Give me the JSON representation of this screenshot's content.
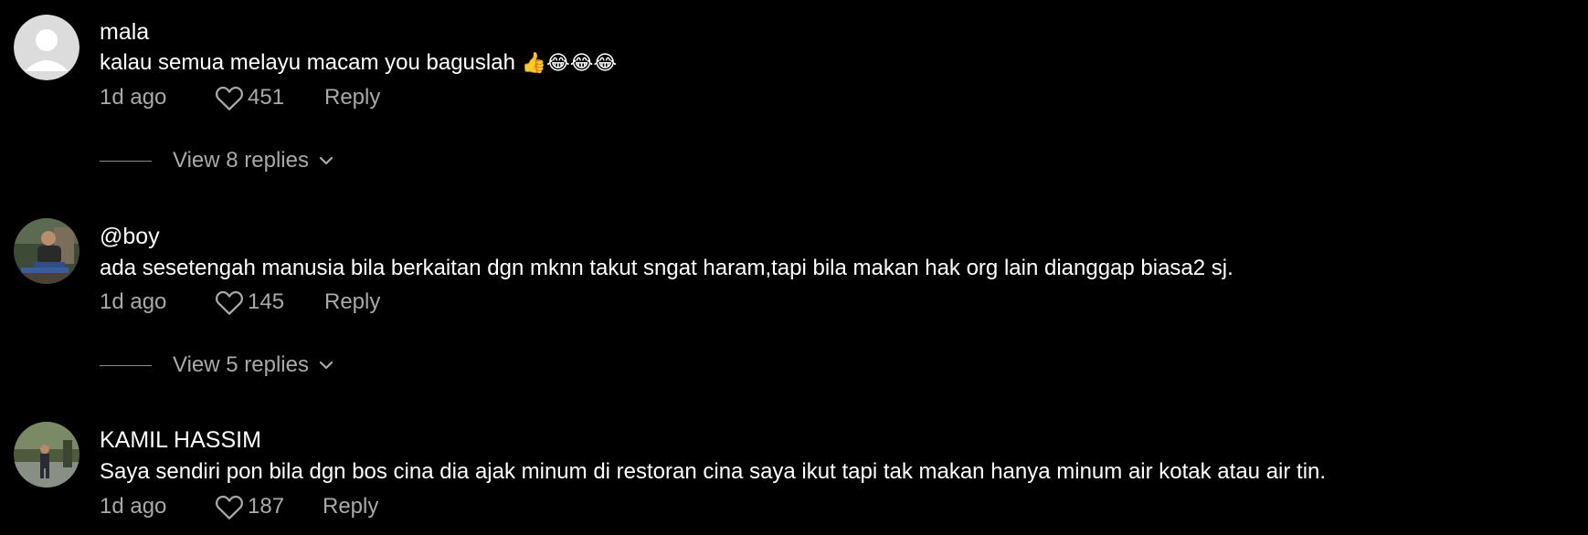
{
  "comments": [
    {
      "username": "mala",
      "text": "kalau semua melayu macam you baguslah",
      "emojis": "👍😂😂😂",
      "time": "1d ago",
      "likes": "451",
      "reply_label": "Reply",
      "view_replies": "View 8 replies",
      "avatar": "default-avatar"
    },
    {
      "username": "@boy",
      "text": "ada sesetengah manusia bila berkaitan dgn mknn takut sngat haram,tapi bila makan hak org lain dianggap biasa2 sj.",
      "time": "1d ago",
      "likes": "145",
      "reply_label": "Reply",
      "view_replies": "View 5 replies",
      "avatar": "photo-avatar"
    },
    {
      "username": "KAMIL HASSIM",
      "text": "Saya sendiri pon bila dgn bos cina dia ajak minum di restoran cina saya ikut tapi tak makan hanya minum air kotak atau air tin.",
      "time": "1d ago",
      "likes": "187",
      "reply_label": "Reply",
      "avatar": "photo-avatar"
    }
  ],
  "icons": {
    "like": "heart-outline-icon",
    "expand": "chevron-down-icon"
  },
  "colors": {
    "background": "#000000",
    "primary_text": "#ffffff",
    "secondary_text": "#a9a9a9"
  }
}
